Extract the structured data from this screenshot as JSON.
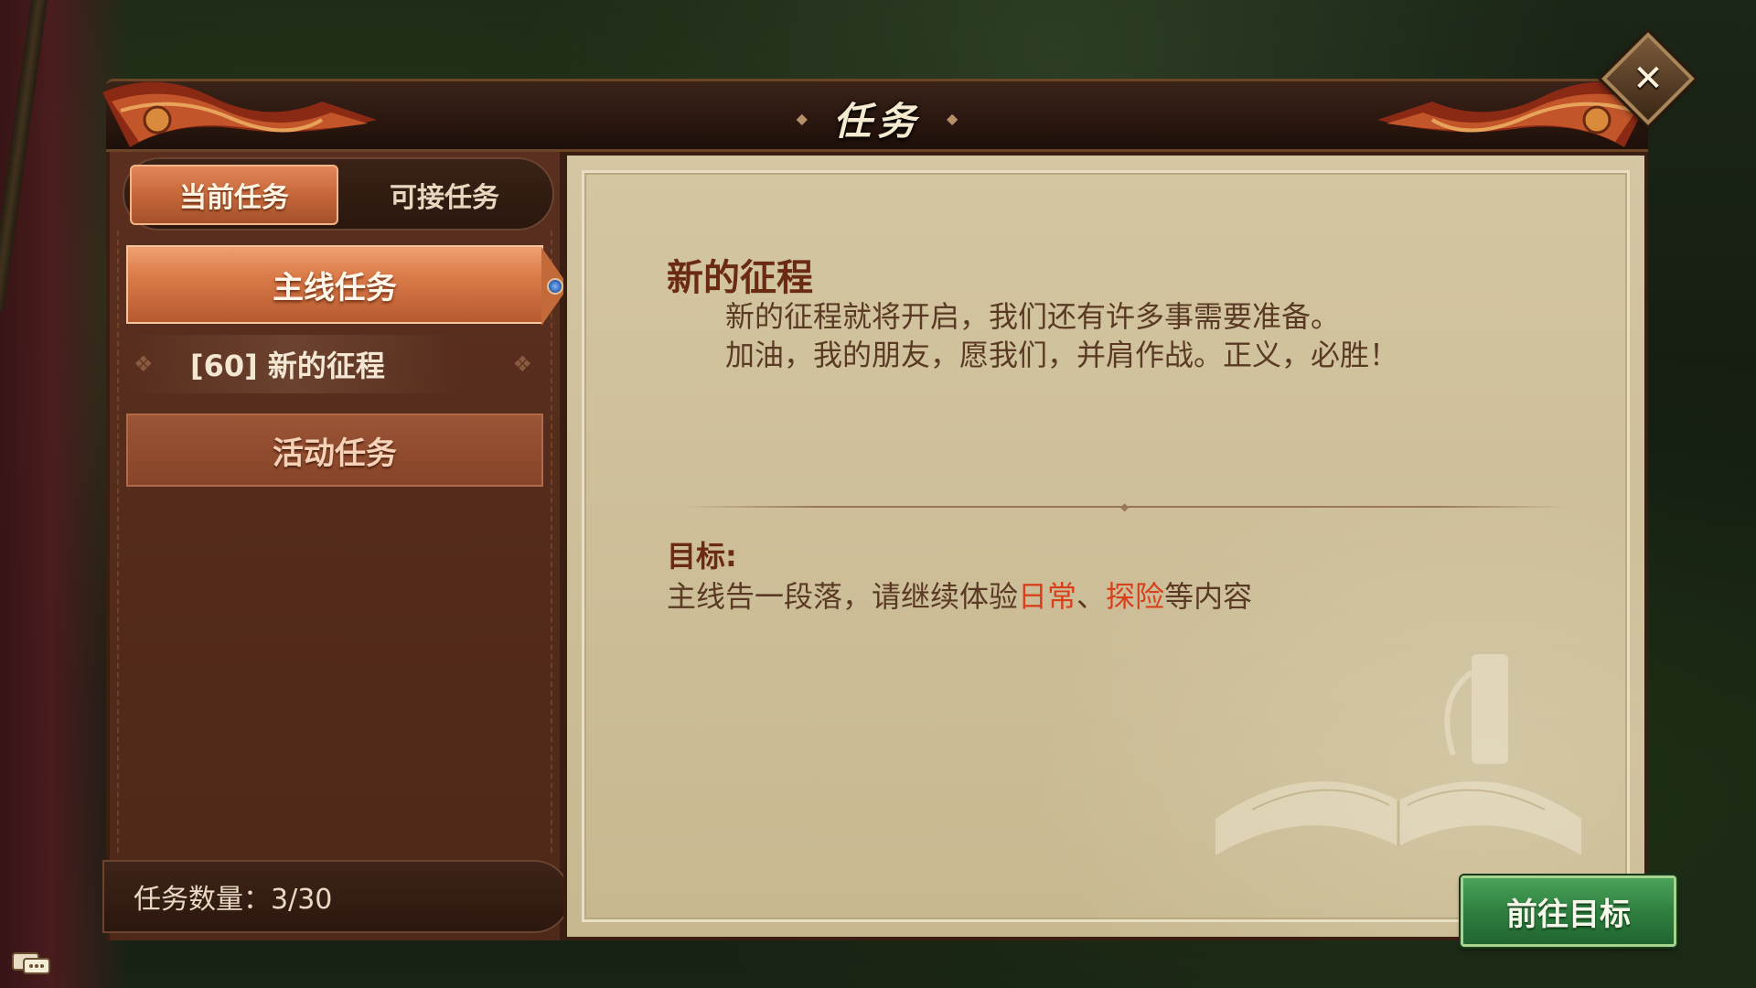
{
  "dialog": {
    "title": "任务"
  },
  "tabs": [
    {
      "label": "当前任务",
      "active": true
    },
    {
      "label": "可接任务",
      "active": false
    }
  ],
  "categories": {
    "main": "主线任务",
    "activity": "活动任务"
  },
  "quest_list": [
    {
      "label": "[60] 新的征程"
    }
  ],
  "quest_count": "任务数量：3/30",
  "detail": {
    "title": "新的征程",
    "description_line1": "新的征程就将开启，我们还有许多事需要准备。",
    "description_line2": "加油，我的朋友，愿我们，并肩作战。正义，必胜！",
    "goal_label": "目标:",
    "goal_prefix": "主线告一段落，请继续体验",
    "goal_highlight1": "日常",
    "goal_sep": "、",
    "goal_highlight2": "探险",
    "goal_suffix": "等内容"
  },
  "go_button": "前往目标",
  "colors": {
    "highlight": "#d8401c",
    "button_green": "#2f8040",
    "tab_active": "#d97a48",
    "title_text": "#6a2a14"
  },
  "icons": [
    "close-icon",
    "chat-icon",
    "gem-icon",
    "book-decoration"
  ]
}
